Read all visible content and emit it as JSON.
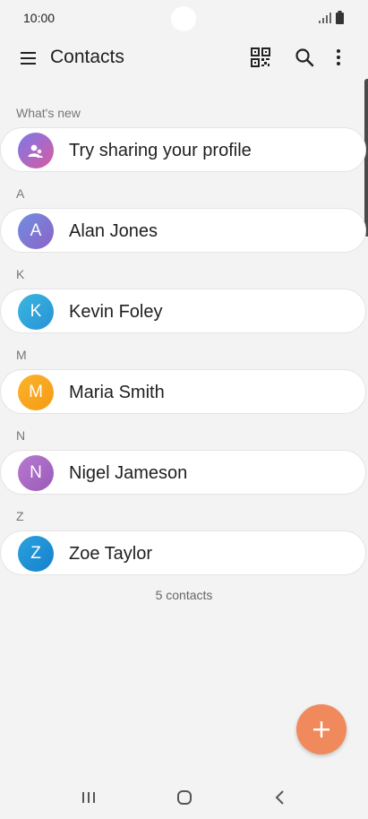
{
  "status": {
    "time": "10:00"
  },
  "app_bar": {
    "title": "Contacts"
  },
  "whats_new": {
    "label": "What's new",
    "card_text": "Try sharing your profile"
  },
  "sections": [
    {
      "letter": "A",
      "name": "Alan Jones",
      "initial": "A",
      "color": "#7e6fd4"
    },
    {
      "letter": "K",
      "name": "Kevin Foley",
      "initial": "K",
      "color": "#2ea3d8"
    },
    {
      "letter": "M",
      "name": "Maria Smith",
      "initial": "M",
      "color": "#f8a61f"
    },
    {
      "letter": "N",
      "name": "Nigel Jameson",
      "initial": "N",
      "color": "#a86ac4"
    },
    {
      "letter": "Z",
      "name": "Zoe Taylor",
      "initial": "Z",
      "color": "#1e8fd5"
    }
  ],
  "footer": {
    "count": "5 contacts"
  },
  "icons": [
    "menu-icon",
    "qr-code-icon",
    "search-icon",
    "more-vertical-icon",
    "add-icon",
    "recent-apps-icon",
    "home-icon",
    "back-icon"
  ],
  "colors": {
    "fab": "#f08a5d",
    "background": "#f3f3f3"
  }
}
